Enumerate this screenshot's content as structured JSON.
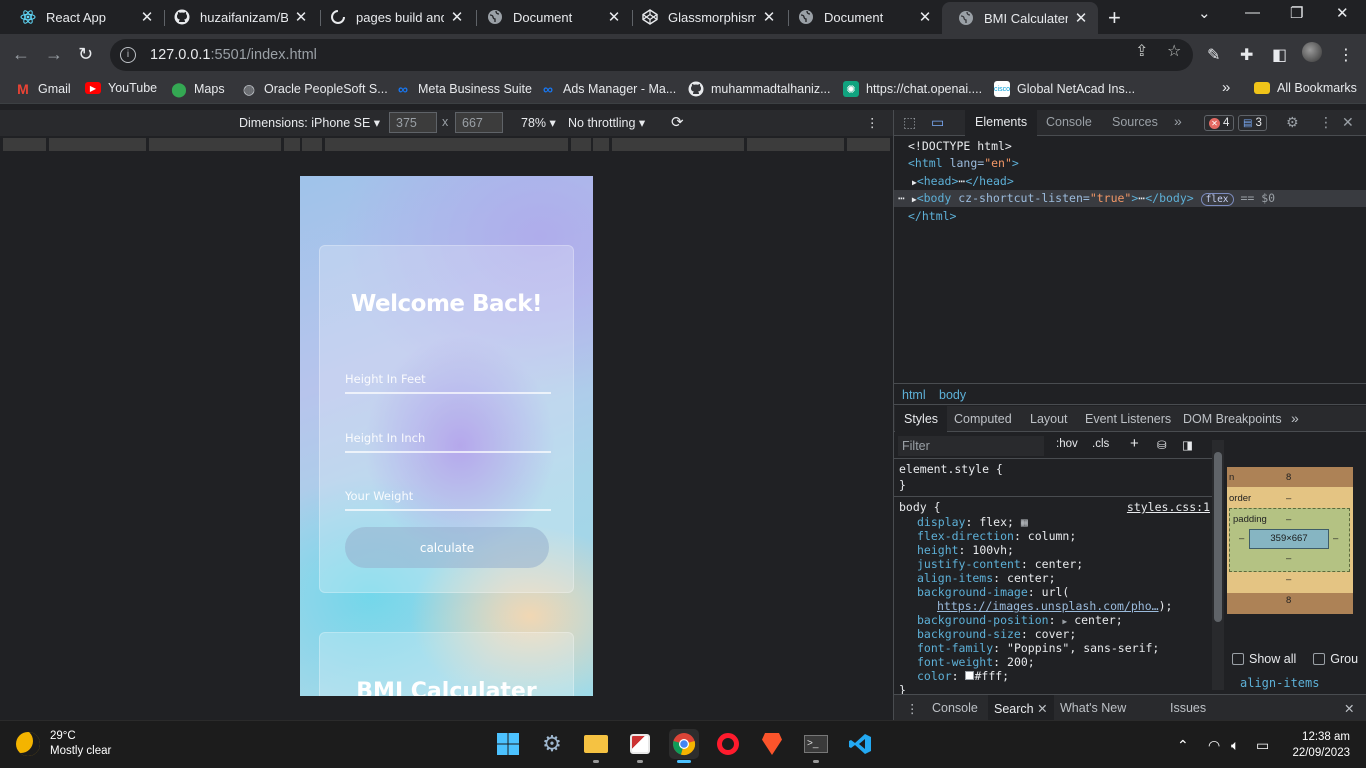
{
  "browser": {
    "tabs": [
      {
        "title": "React App",
        "icon": "react-icon"
      },
      {
        "title": "huzaifanizam/Birt",
        "icon": "github-icon"
      },
      {
        "title": "pages build and d",
        "icon": "github-actions-icon"
      },
      {
        "title": "Document",
        "icon": "globe-icon"
      },
      {
        "title": "Glassmorphism U",
        "icon": "codepen-icon"
      },
      {
        "title": "Document",
        "icon": "globe-icon"
      },
      {
        "title": "BMI Calculater Ap",
        "icon": "globe-icon"
      }
    ],
    "url_host": "127.0.0.1",
    "url_rest": ":5501/index.html",
    "bookmarks": [
      {
        "label": "Gmail",
        "icon": "gmail-icon"
      },
      {
        "label": "YouTube",
        "icon": "youtube-icon"
      },
      {
        "label": "Maps",
        "icon": "maps-icon"
      },
      {
        "label": "Oracle PeopleSoft S...",
        "icon": "globe-icon"
      },
      {
        "label": "Meta Business Suite",
        "icon": "meta-icon"
      },
      {
        "label": "Ads Manager - Ma...",
        "icon": "meta-icon"
      },
      {
        "label": "muhammadtalhaniz...",
        "icon": "github-icon"
      },
      {
        "label": "https://chat.openai....",
        "icon": "openai-icon"
      },
      {
        "label": "Global NetAcad Ins...",
        "icon": "cisco-icon"
      }
    ],
    "all_bookmarks": "All Bookmarks",
    "more_bookmarks": "»"
  },
  "device_toolbar": {
    "dimensions": "Dimensions: iPhone SE",
    "width": "375",
    "times": "x",
    "height": "667",
    "zoom": "78%",
    "throttling": "No throttling"
  },
  "page": {
    "welcome": "Welcome Back!",
    "height_feet_placeholder": "Height In Feet",
    "height_inch_placeholder": "Height In Inch",
    "weight_placeholder": "Your Weight",
    "calculate": "calculate",
    "bmi_title": "BMI Calculater"
  },
  "devtools": {
    "tabs": [
      "Elements",
      "Console",
      "Sources"
    ],
    "more_tabs": "»",
    "errors": "4",
    "messages": "3",
    "dom": {
      "doctype": "<!DOCTYPE html>",
      "html_open_tag": "<html",
      "html_lang_attr": "lang=",
      "html_lang_val": "\"en\"",
      "html_open_close": ">",
      "head_open": "<head>",
      "ellipsis": "⋯",
      "head_close": "</head>",
      "body_open": "<body",
      "body_attr": "cz-shortcut-listen=",
      "body_attr_val": "\"true\"",
      "body_open_close": ">",
      "body_close": "</body>",
      "flex_badge": "flex",
      "equals_var": "== $0",
      "html_close": "</html>"
    },
    "breadcrumbs": [
      "html",
      "body"
    ],
    "subtabs": [
      "Styles",
      "Computed",
      "Layout",
      "Event Listeners",
      "DOM Breakpoints"
    ],
    "more_subtabs": "»",
    "filter_placeholder": "Filter",
    "hov": ":hov",
    "cls": ".cls",
    "element_style": "element.style {",
    "close_brace": "}",
    "rule_selector": "body {",
    "rule_source": "styles.css:1",
    "declarations": [
      {
        "prop": "display",
        "value": "flex;"
      },
      {
        "prop": "flex-direction",
        "value": "column;"
      },
      {
        "prop": "height",
        "value": "100vh;"
      },
      {
        "prop": "justify-content",
        "value": "center;"
      },
      {
        "prop": "align-items",
        "value": "center;"
      },
      {
        "prop": "background-image",
        "value": "url("
      },
      {
        "prop": "background-position",
        "value": "center;"
      },
      {
        "prop": "background-size",
        "value": "cover;"
      },
      {
        "prop": "font-family",
        "value": "\"Poppins\", sans-serif;"
      },
      {
        "prop": "font-weight",
        "value": "200;"
      },
      {
        "prop": "color",
        "value": "#fff;"
      }
    ],
    "bg_url": "https://images.unsplash.com/pho…",
    "bg_url_end": ");",
    "box_model": {
      "margin_label": "n",
      "margin_top": "8",
      "margin_bottom": "8",
      "border_label": "order",
      "border_top": "–",
      "border_bottom": "–",
      "padding_label": "padding",
      "padding_top": "–",
      "padding_bottom": "–",
      "padding_left": "–",
      "padding_right": "–",
      "content": "359×667"
    },
    "show_all": "Show all",
    "group": "Grou",
    "computed_prop": "align-items",
    "drawer_tabs": [
      "Console",
      "Search",
      "What's New",
      "Issues"
    ]
  },
  "taskbar": {
    "temperature": "29°C",
    "weather": "Mostly clear",
    "time": "12:38 am",
    "date": "22/09/2023"
  }
}
